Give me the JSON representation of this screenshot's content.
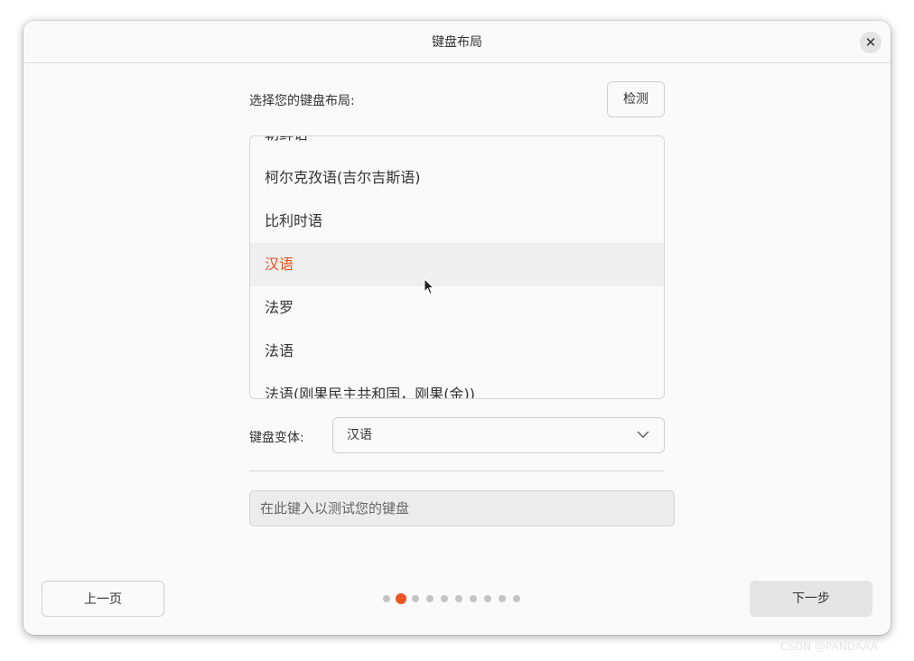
{
  "window": {
    "title": "键盘布局",
    "close_icon": "close-icon"
  },
  "layout": {
    "prompt": "选择您的键盘布局:",
    "detect_label": "检测",
    "items": [
      {
        "label": "朝鲜语",
        "selected": false
      },
      {
        "label": "柯尔克孜语(吉尔吉斯语)",
        "selected": false
      },
      {
        "label": "比利时语",
        "selected": false
      },
      {
        "label": "汉语",
        "selected": true
      },
      {
        "label": "法罗",
        "selected": false
      },
      {
        "label": "法语",
        "selected": false
      },
      {
        "label": "法语(刚果民主共和国，刚果(金))",
        "selected": false
      }
    ]
  },
  "variant": {
    "label": "键盘变体:",
    "value": "汉语",
    "icon": "chevron-down-icon"
  },
  "test_field": {
    "placeholder": "在此键入以测试您的键盘",
    "value": ""
  },
  "navigation": {
    "prev_label": "上一页",
    "next_label": "下一步",
    "pages": 10,
    "current_page": 2
  },
  "watermark": "CSDN @PANDAAA",
  "colors": {
    "accent": "#e95420",
    "window_bg": "#fafafa",
    "selected_row_bg": "#efefef"
  }
}
